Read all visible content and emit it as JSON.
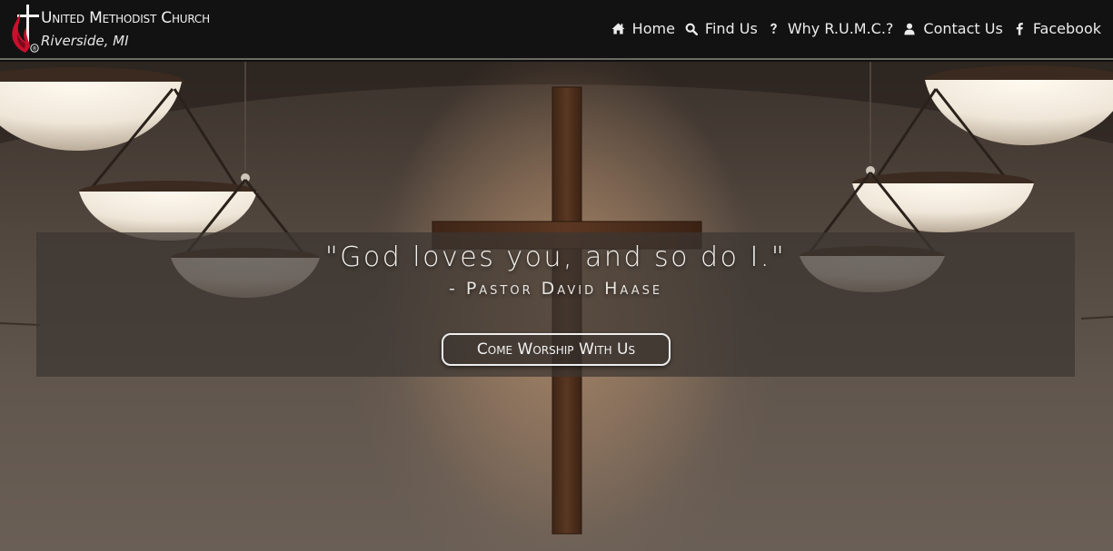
{
  "brand": {
    "name": "United Methodist Church",
    "location": "Riverside, MI",
    "logo_icon": "cross-and-flame-icon",
    "registered_mark": "®"
  },
  "nav": {
    "items": [
      {
        "label": "Home",
        "icon": "home-icon"
      },
      {
        "label": "Find Us",
        "icon": "search-icon"
      },
      {
        "label": "Why R.U.M.C.?",
        "icon": "question-icon"
      },
      {
        "label": "Contact Us",
        "icon": "user-icon"
      },
      {
        "label": "Facebook",
        "icon": "facebook-icon"
      }
    ]
  },
  "hero": {
    "quote": "\"God loves you, and so do I.\"",
    "author": "- Pastor David Haase",
    "cta_label": "Come Worship With Us"
  },
  "colors": {
    "navbar_bg": "#121212",
    "flame_red": "#c8102e",
    "band_bg": "#3c3632",
    "text_light": "#f2f2f2"
  }
}
